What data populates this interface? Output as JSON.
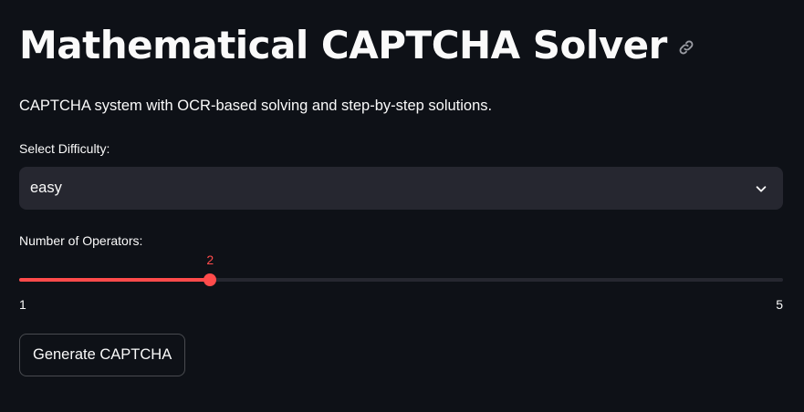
{
  "header": {
    "title": "Mathematical CAPTCHA Solver",
    "anchor_icon": "link-icon"
  },
  "subtitle": "CAPTCHA system with OCR-based solving and step-by-step solutions.",
  "difficulty": {
    "label": "Select Difficulty:",
    "selected": "easy",
    "icon": "chevron-down-icon"
  },
  "operators": {
    "label": "Number of Operators:",
    "value": 2,
    "min": 1,
    "max": 5,
    "value_text": "2",
    "min_text": "1",
    "max_text": "5"
  },
  "generate_button": {
    "label": "Generate CAPTCHA"
  },
  "colors": {
    "background": "#0e1117",
    "surface": "#262730",
    "accent": "#ff4b4b",
    "text": "#fafafa"
  }
}
